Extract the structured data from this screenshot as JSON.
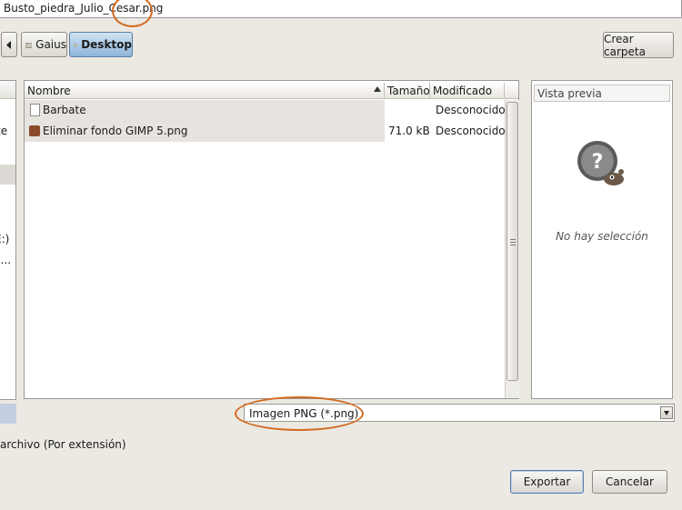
{
  "filename": {
    "value": "Busto_piedra_Julio_Cesar.png"
  },
  "breadcrumbs": [
    {
      "label": "Gaius"
    },
    {
      "label": "Desktop",
      "active": true
    }
  ],
  "create_folder_label": "Crear carpeta",
  "places_partial": [
    "te",
    "E:)",
    "(..."
  ],
  "file_list": {
    "columns": [
      "Nombre",
      "Tamaño",
      "Modificado"
    ],
    "rows": [
      {
        "icon": "folder-doc-icon",
        "name": "Barbate",
        "size": "",
        "modified": "Desconocido"
      },
      {
        "icon": "image-file-icon",
        "name": "Eliminar fondo GIMP 5.png",
        "size": "71.0 kB",
        "modified": "Desconocido"
      }
    ]
  },
  "preview": {
    "title": "Vista previa",
    "message": "No hay selección"
  },
  "filter": {
    "selected": "Imagen PNG (*.png)"
  },
  "filetype_label": "archivo (Por extensión)",
  "buttons": {
    "export": "Exportar",
    "cancel": "Cancelar"
  },
  "colors": {
    "annotation": "#d2691e",
    "active_crumb": "#8eb5d8"
  }
}
